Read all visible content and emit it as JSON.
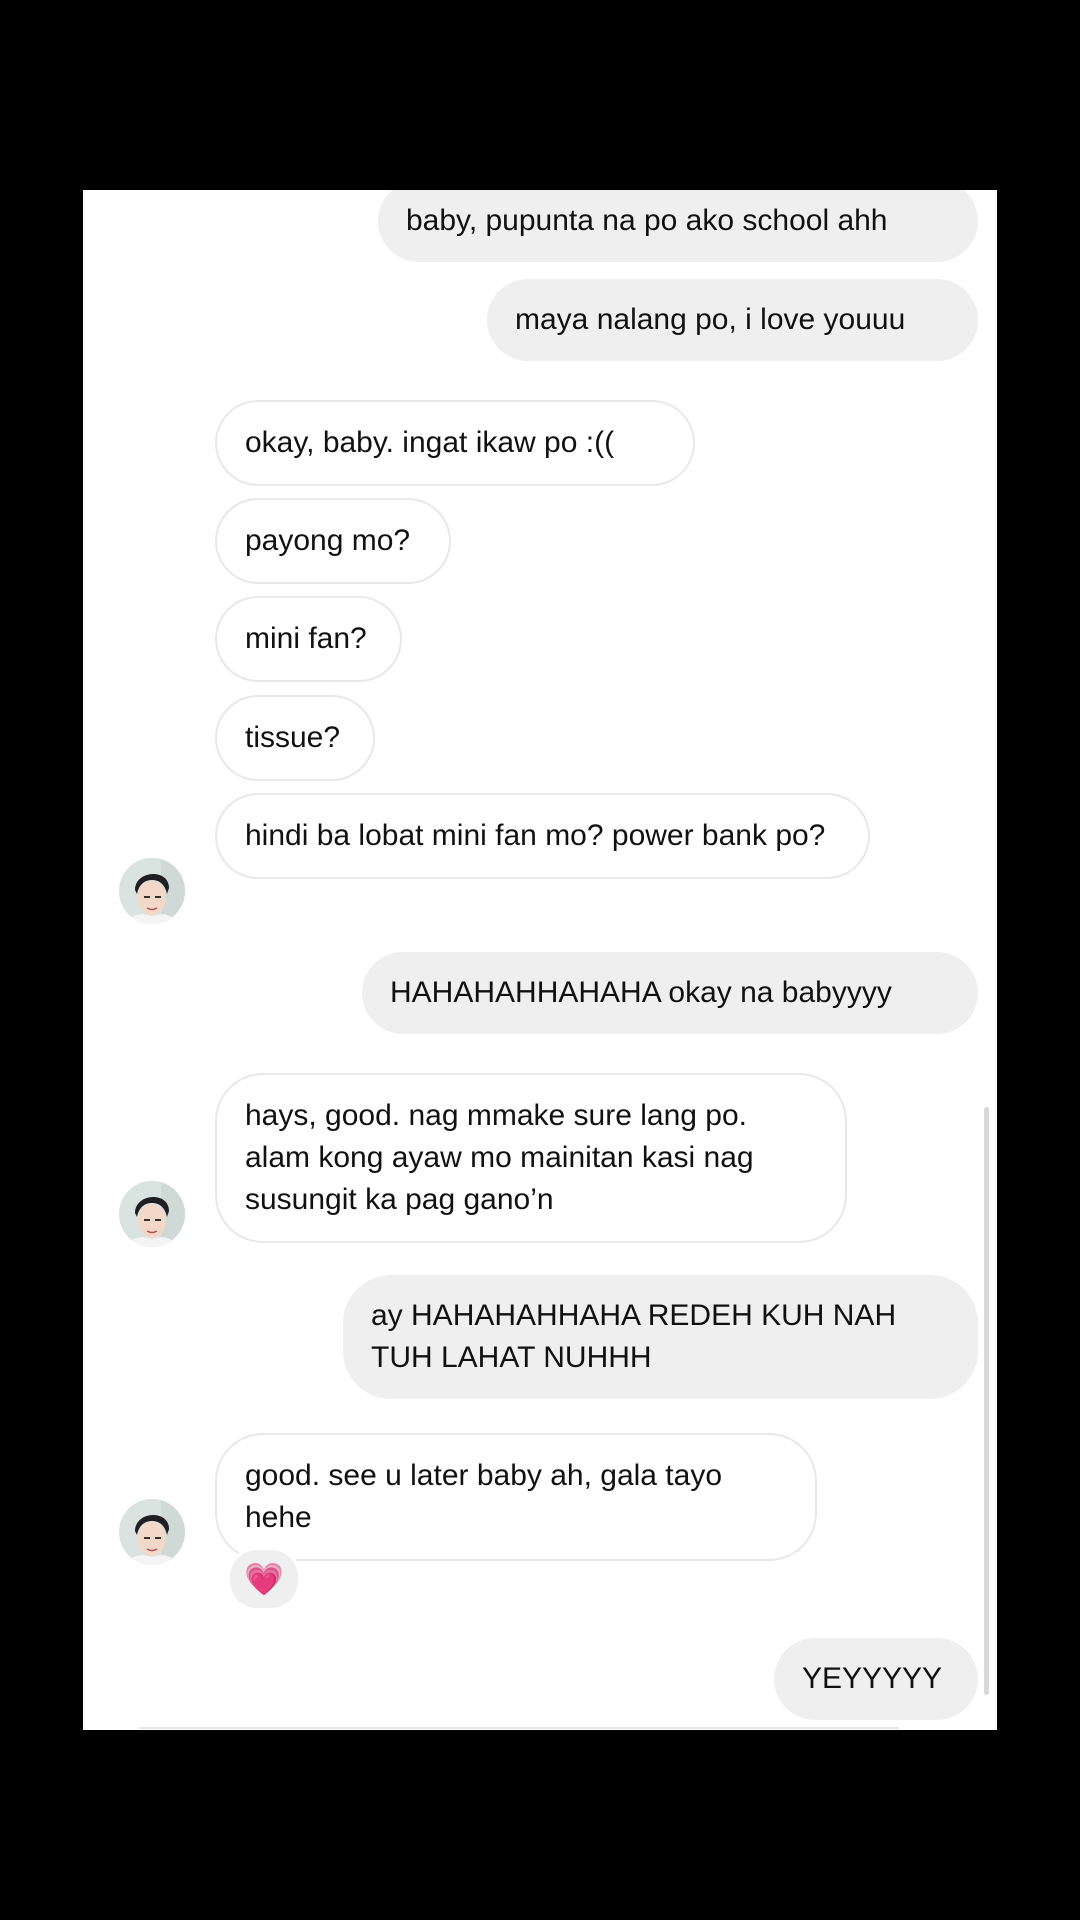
{
  "conversation": {
    "messages": [
      {
        "id": "m1",
        "direction": "out",
        "text": "baby, pupunta na po ako school ahh"
      },
      {
        "id": "m2",
        "direction": "out",
        "text": "maya nalang po, i love youuu"
      },
      {
        "id": "m3",
        "direction": "in",
        "text": "okay, baby. ingat ikaw po :(("
      },
      {
        "id": "m4",
        "direction": "in",
        "text": "payong mo?"
      },
      {
        "id": "m5",
        "direction": "in",
        "text": "mini fan?"
      },
      {
        "id": "m6",
        "direction": "in",
        "text": "tissue?"
      },
      {
        "id": "m7",
        "direction": "in",
        "text": "hindi ba lobat mini fan mo? power bank po?"
      },
      {
        "id": "m8",
        "direction": "out",
        "text": "HAHAHAHHAHAHA okay na babyyyy"
      },
      {
        "id": "m9",
        "direction": "in",
        "text": "hays, good. nag mmake sure lang po. alam kong ayaw mo mainitan kasi nag susungit ka pag gano’n"
      },
      {
        "id": "m10",
        "direction": "out",
        "text": "ay HAHAHAHHAHA REDEH KUH NAH TUH LAHAT NUHHH"
      },
      {
        "id": "m11",
        "direction": "in",
        "text": "good. see u later baby ah, gala tayo hehe"
      },
      {
        "id": "m12",
        "direction": "out",
        "text": "YEYYYYY"
      }
    ],
    "reaction": {
      "emoji": "💗",
      "icon": "heart-reaction-icon"
    }
  },
  "colors": {
    "background": "#000000",
    "panel": "#ffffff",
    "outgoing_bubble": "#efefef",
    "incoming_border": "#e8e8e8"
  }
}
